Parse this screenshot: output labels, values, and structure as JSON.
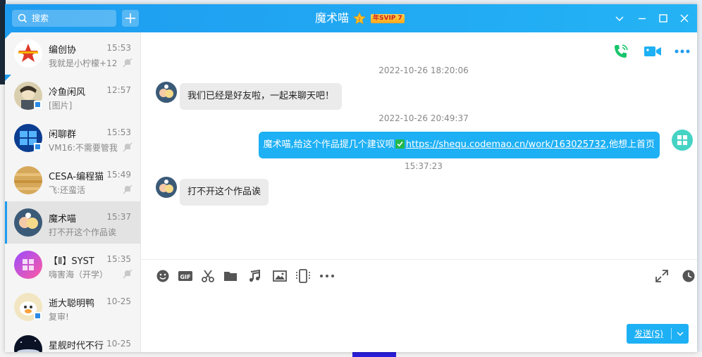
{
  "window": {
    "title": "魔术喵",
    "vip_badge": "年SVIP 7",
    "search_placeholder": "搜索"
  },
  "conversations": [
    {
      "name": "编创协",
      "time": "15:53",
      "preview": "我就是小柠檬+12",
      "muted": true,
      "pinned": true
    },
    {
      "name": "冷鱼闲风",
      "time": "12:57",
      "preview": "[图片]",
      "muted": false,
      "pinned": true
    },
    {
      "name": "闲聊群",
      "time": "15:53",
      "preview": "VM16:不需要管我",
      "muted": true,
      "pinned": false
    },
    {
      "name": "CESA-编程猫",
      "time": "15:49",
      "preview": "飞:还蛮活",
      "muted": true,
      "pinned": false
    },
    {
      "name": "魔术喵",
      "time": "15:37",
      "preview": "打不开这个作品诶",
      "muted": false,
      "pinned": false,
      "active": true
    },
    {
      "name": "【Ⅱ】SYST",
      "time": "15:35",
      "preview": "嗨害海（开学）",
      "muted": true,
      "pinned": false
    },
    {
      "name": "逝大聪明鸭",
      "time": "10-25",
      "preview": "复审!",
      "muted": false,
      "pinned": false
    },
    {
      "name": "星舰时代不行",
      "time": "10-25",
      "preview": "",
      "muted": false,
      "pinned": false
    }
  ],
  "messages": {
    "ts1": "2022-10-26 18:20:06",
    "msg1": "我们已经是好友啦，一起来聊天吧！",
    "ts2": "2022-10-26 20:49:37",
    "msg2_prefix": "魔术喵,给这个作品提几个建议呗",
    "msg2_link": "https://shequ.codemao.cn/work/163025732",
    "msg2_suffix": ",他想上首页",
    "ts3": "15:37:23",
    "msg3": "打不开这个作品诶"
  },
  "input": {
    "send_label": "发送(S)"
  },
  "colors": {
    "accent": "#1e9cf0",
    "bubble_out": "#1eb0f4",
    "bubble_in": "#ebebeb",
    "phone_green": "#18c46b"
  },
  "toolbar_icons": [
    "emoji-icon",
    "gif-icon",
    "scissors-icon",
    "folder-icon",
    "music-icon",
    "image-icon",
    "screen-share-icon",
    "more-icon"
  ]
}
